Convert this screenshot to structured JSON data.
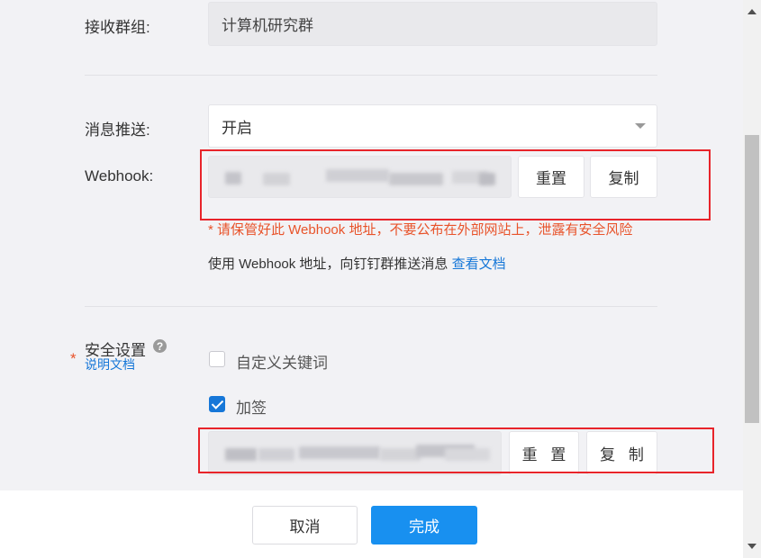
{
  "group": {
    "label": "接收群组:",
    "value": "计算机研究群"
  },
  "push": {
    "label": "消息推送:",
    "value": "开启"
  },
  "webhook": {
    "label": "Webhook:",
    "reset_label": "重置",
    "copy_label": "复制",
    "warning": "* 请保管好此 Webhook 地址，不要公布在外部网站上，泄露有安全风险",
    "info": "使用 Webhook 地址，向钉钉群推送消息",
    "doc_link": "查看文档"
  },
  "security": {
    "required_mark": "*",
    "label": "安全设置",
    "help_icon": "question-circle-icon",
    "doc_link": "说明文档",
    "keyword_label": "自定义关键词",
    "keyword_checked": false,
    "sign_label": "加签",
    "sign_checked": true,
    "reset_label": "重 置",
    "copy_label": "复 制"
  },
  "footer": {
    "cancel_label": "取消",
    "done_label": "完成"
  },
  "colors": {
    "primary": "#1890f0",
    "link": "#1677d8",
    "warning": "#e8532a",
    "highlight": "#e8242a"
  }
}
